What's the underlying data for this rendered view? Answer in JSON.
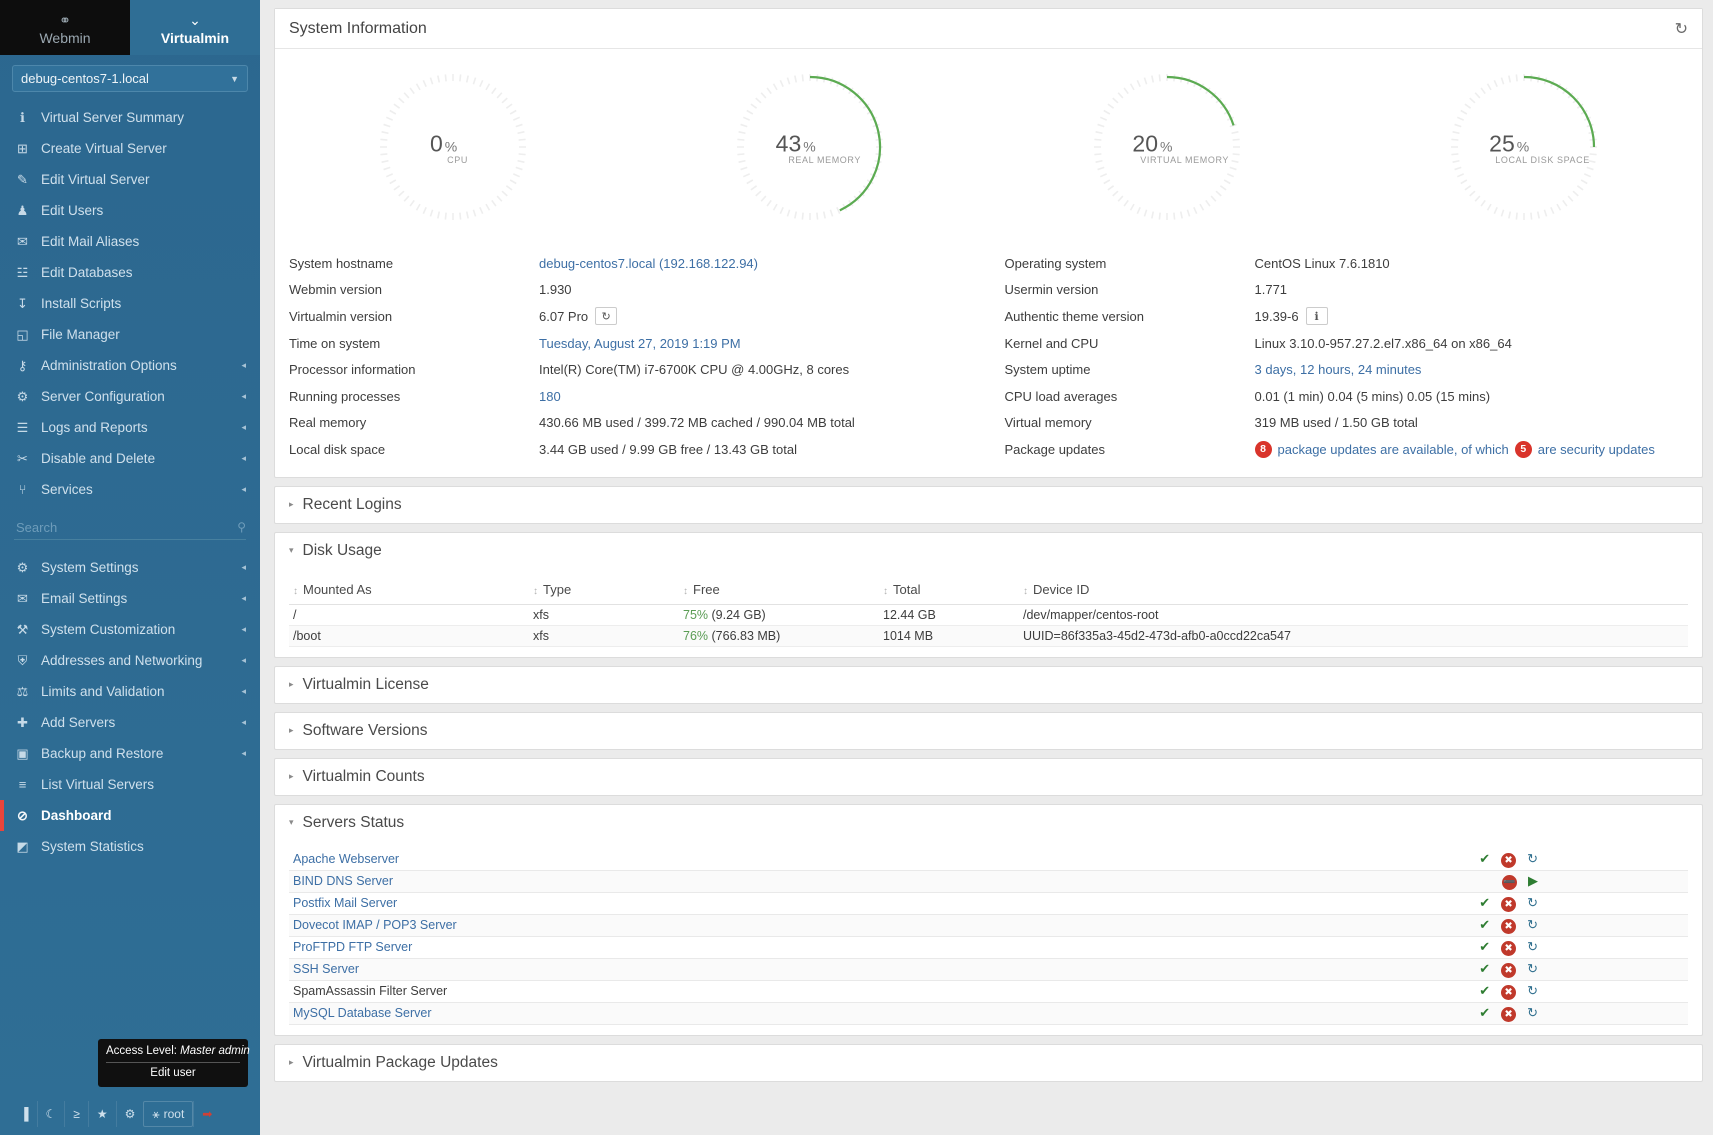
{
  "sidebar": {
    "brand": {
      "webmin": "Webmin",
      "virtualmin": "Virtualmin"
    },
    "host_select": {
      "value": "debug-centos7-1.local",
      "caret": "chevron-down-icon"
    },
    "nav_top": [
      {
        "label": "Virtual Server Summary",
        "icon": "info-icon",
        "arrow": "",
        "active": false
      },
      {
        "label": "Create Virtual Server",
        "icon": "plus-box-icon",
        "arrow": "",
        "active": false
      },
      {
        "label": "Edit Virtual Server",
        "icon": "edit-icon",
        "arrow": "",
        "active": false
      },
      {
        "label": "Edit Users",
        "icon": "users-icon",
        "arrow": "",
        "active": false
      },
      {
        "label": "Edit Mail Aliases",
        "icon": "envelope-icon",
        "arrow": "",
        "active": false
      },
      {
        "label": "Edit Databases",
        "icon": "database-icon",
        "arrow": "",
        "active": false
      },
      {
        "label": "Install Scripts",
        "icon": "download-box-icon",
        "arrow": "",
        "active": false
      },
      {
        "label": "File Manager",
        "icon": "folder-icon",
        "arrow": "",
        "active": false
      },
      {
        "label": "Administration Options",
        "icon": "key-icon",
        "arrow": "◂",
        "active": false
      },
      {
        "label": "Server Configuration",
        "icon": "gears-icon",
        "arrow": "◂",
        "active": false
      },
      {
        "label": "Logs and Reports",
        "icon": "document-icon",
        "arrow": "◂",
        "active": false
      },
      {
        "label": "Disable and Delete",
        "icon": "plug-icon",
        "arrow": "◂",
        "active": false
      },
      {
        "label": "Services",
        "icon": "puzzle-icon",
        "arrow": "◂",
        "active": false
      }
    ],
    "search": {
      "placeholder": "Search",
      "icon": "search-icon"
    },
    "nav_bottom": [
      {
        "label": "System Settings",
        "icon": "gear-icon",
        "arrow": "◂",
        "active": false
      },
      {
        "label": "Email Settings",
        "icon": "envelope-icon",
        "arrow": "◂",
        "active": false
      },
      {
        "label": "System Customization",
        "icon": "wrench-icon",
        "arrow": "◂",
        "active": false
      },
      {
        "label": "Addresses and Networking",
        "icon": "shield-icon",
        "arrow": "◂",
        "active": false
      },
      {
        "label": "Limits and Validation",
        "icon": "scale-icon",
        "arrow": "◂",
        "active": false
      },
      {
        "label": "Add Servers",
        "icon": "plus-icon",
        "arrow": "◂",
        "active": false
      },
      {
        "label": "Backup and Restore",
        "icon": "save-icon",
        "arrow": "◂",
        "active": false
      },
      {
        "label": "List Virtual Servers",
        "icon": "list-icon",
        "arrow": "",
        "active": false
      },
      {
        "label": "Dashboard",
        "icon": "dashboard-icon",
        "arrow": "",
        "active": true
      },
      {
        "label": "System Statistics",
        "icon": "chart-icon",
        "arrow": "",
        "active": false
      }
    ],
    "tooltip": {
      "line1_label": "Access Level:",
      "line1_value": "Master admin",
      "line2": "Edit user"
    },
    "bottombar": [
      {
        "label": "",
        "icon": "collapse-sidebar-icon"
      },
      {
        "label": "",
        "icon": "night-mode-icon"
      },
      {
        "label": "",
        "icon": "terminal-icon"
      },
      {
        "label": "",
        "icon": "favorites-star-icon"
      },
      {
        "label": "",
        "icon": "theme-config-icon"
      },
      {
        "label": "root",
        "icon": "user-icon"
      },
      {
        "label": "",
        "icon": "logout-icon"
      }
    ]
  },
  "header": {
    "title": "System Information",
    "refresh_icon": "refresh-icon"
  },
  "chart_data": [
    {
      "type": "gauge",
      "title": "CPU",
      "value": 0,
      "unit": "%",
      "max": 100,
      "value_label": "0",
      "arc_color": "#5cab52",
      "track_color": "#eeeeee"
    },
    {
      "type": "gauge",
      "title": "REAL MEMORY",
      "value": 43,
      "unit": "%",
      "max": 100,
      "value_label": "43",
      "arc_color": "#5cab52",
      "track_color": "#eeeeee"
    },
    {
      "type": "gauge",
      "title": "VIRTUAL MEMORY",
      "value": 20,
      "unit": "%",
      "max": 100,
      "value_label": "20",
      "arc_color": "#5cab52",
      "track_color": "#eeeeee"
    },
    {
      "type": "gauge",
      "title": "LOCAL DISK SPACE",
      "value": 25,
      "unit": "%",
      "max": 100,
      "value_label": "25",
      "arc_color": "#5cab52",
      "track_color": "#eeeeee"
    }
  ],
  "system_info": {
    "left": [
      {
        "key": "System hostname",
        "value": "debug-centos7.local (192.168.122.94)",
        "style": "link"
      },
      {
        "key": "Webmin version",
        "value": "1.930",
        "style": "text"
      },
      {
        "key": "Virtualmin version",
        "value": "6.07 Pro",
        "style": "text",
        "button": "refresh-icon"
      },
      {
        "key": "Time on system",
        "value": "Tuesday, August 27, 2019 1:19 PM",
        "style": "link"
      },
      {
        "key": "Processor information",
        "value": "Intel(R) Core(TM) i7-6700K CPU @ 4.00GHz, 8 cores",
        "style": "text"
      },
      {
        "key": "Running processes",
        "value": "180",
        "style": "link"
      },
      {
        "key": "Real memory",
        "value": "430.66 MB used / 399.72 MB cached / 990.04 MB total",
        "style": "text"
      },
      {
        "key": "Local disk space",
        "value": "3.44 GB used / 9.99 GB free / 13.43 GB total",
        "style": "text"
      }
    ],
    "right": [
      {
        "key": "Operating system",
        "value": "CentOS Linux 7.6.1810",
        "style": "text"
      },
      {
        "key": "Usermin version",
        "value": "1.771",
        "style": "text"
      },
      {
        "key": "Authentic theme version",
        "value": "19.39-6",
        "style": "text",
        "button": "info-icon"
      },
      {
        "key": "Kernel and CPU",
        "value": "Linux 3.10.0-957.27.2.el7.x86_64 on x86_64",
        "style": "text"
      },
      {
        "key": "System uptime",
        "value": "3 days, 12 hours, 24 minutes",
        "style": "link"
      },
      {
        "key": "CPU load averages",
        "value": "0.01 (1 min) 0.04 (5 mins) 0.05 (15 mins)",
        "style": "text"
      },
      {
        "key": "Virtual memory",
        "value": "319 MB used / 1.50 GB total",
        "style": "text"
      }
    ],
    "package_updates": {
      "key": "Package updates",
      "count": "8",
      "text1": "package updates are available, of which",
      "security_count": "5",
      "text2": "are security updates",
      "badge_color": "#d9342b"
    }
  },
  "sections": {
    "recent_logins": {
      "title": "Recent Logins",
      "collapsed": true,
      "tri": "▸"
    },
    "disk_usage": {
      "title": "Disk Usage",
      "collapsed": false,
      "tri": "▾",
      "columns": [
        "Mounted As",
        "Type",
        "Free",
        "Total",
        "Device ID"
      ],
      "rows": [
        {
          "mounted": "/",
          "type": "xfs",
          "free_pct": "75%",
          "free_size": "(9.24 GB)",
          "total": "12.44 GB",
          "device": "/dev/mapper/centos-root"
        },
        {
          "mounted": "/boot",
          "type": "xfs",
          "free_pct": "76%",
          "free_size": "(766.83 MB)",
          "total": "1014 MB",
          "device": "UUID=86f335a3-45d2-473d-afb0-a0ccd22ca547"
        }
      ]
    },
    "virtualmin_license": {
      "title": "Virtualmin License",
      "collapsed": true,
      "tri": "▸"
    },
    "software_versions": {
      "title": "Software Versions",
      "collapsed": true,
      "tri": "▸"
    },
    "virtualmin_counts": {
      "title": "Virtualmin Counts",
      "collapsed": true,
      "tri": "▸"
    },
    "servers_status": {
      "title": "Servers Status",
      "collapsed": false,
      "tri": "▾",
      "rows": [
        {
          "name": "Apache Webserver",
          "link": true,
          "actions": [
            "check-icon",
            "stop-icon",
            "restart-icon"
          ]
        },
        {
          "name": "BIND DNS Server",
          "link": true,
          "actions": [
            "disabled-icon",
            "start-icon"
          ]
        },
        {
          "name": "Postfix Mail Server",
          "link": true,
          "actions": [
            "check-icon",
            "stop-icon",
            "restart-icon"
          ]
        },
        {
          "name": "Dovecot IMAP / POP3 Server",
          "link": true,
          "actions": [
            "check-icon",
            "stop-icon",
            "restart-icon"
          ]
        },
        {
          "name": "ProFTPD FTP Server",
          "link": true,
          "actions": [
            "check-icon",
            "stop-icon",
            "restart-icon"
          ]
        },
        {
          "name": "SSH Server",
          "link": true,
          "actions": [
            "check-icon",
            "stop-icon",
            "restart-icon"
          ]
        },
        {
          "name": "SpamAssassin Filter Server",
          "link": false,
          "actions": [
            "check-icon",
            "stop-icon",
            "restart-icon"
          ]
        },
        {
          "name": "MySQL Database Server",
          "link": true,
          "actions": [
            "check-icon",
            "stop-icon",
            "restart-icon"
          ]
        }
      ]
    },
    "virtualmin_package_updates": {
      "title": "Virtualmin Package Updates",
      "collapsed": true,
      "tri": "▸"
    }
  }
}
